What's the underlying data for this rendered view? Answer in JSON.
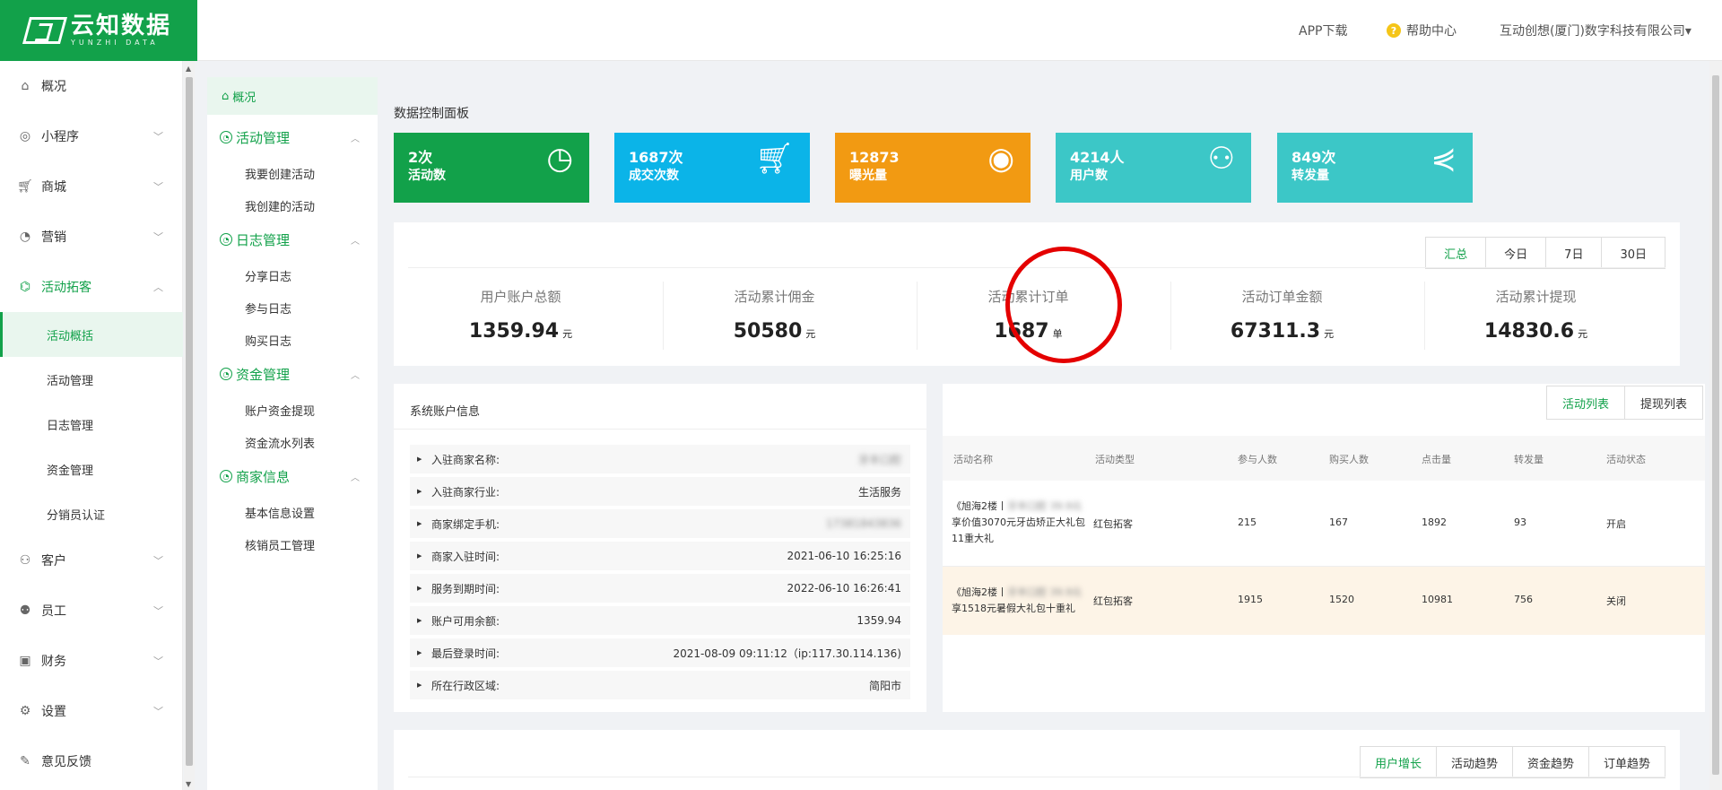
{
  "header": {
    "logo_cn": "云知数据",
    "logo_en": "YUNZHI DATA",
    "app_download": "APP下载",
    "help_center": "帮助中心",
    "company": "互动创想(厦门)数字科技有限公司▾"
  },
  "sidebar": {
    "items": [
      {
        "label": "概况",
        "icon": "home-icon"
      },
      {
        "label": "小程序",
        "icon": "miniprogram-icon"
      },
      {
        "label": "商城",
        "icon": "cart-icon"
      },
      {
        "label": "营销",
        "icon": "marketing-icon"
      },
      {
        "label": "活动拓客",
        "icon": "network-icon"
      },
      {
        "label": "客户",
        "icon": "customer-icon"
      },
      {
        "label": "员工",
        "icon": "staff-icon"
      },
      {
        "label": "财务",
        "icon": "wallet-icon"
      },
      {
        "label": "设置",
        "icon": "gear-icon"
      },
      {
        "label": "意见反馈",
        "icon": "feedback-icon"
      }
    ],
    "sub_items": [
      "活动概括",
      "活动管理",
      "日志管理",
      "资金管理",
      "分销员认证"
    ]
  },
  "submenu": {
    "top": "概况",
    "groups": [
      {
        "label": "活动管理",
        "items": [
          "我要创建活动",
          "我创建的活动"
        ]
      },
      {
        "label": "日志管理",
        "items": [
          "分享日志",
          "参与日志",
          "购买日志"
        ]
      },
      {
        "label": "资金管理",
        "items": [
          "账户资金提现",
          "资金流水列表"
        ]
      },
      {
        "label": "商家信息",
        "items": [
          "基本信息设置",
          "核销员工管理"
        ]
      }
    ]
  },
  "main": {
    "title": "数据控制面板",
    "cards": [
      {
        "value": "2次",
        "label": "活动数",
        "color": "#12a14a",
        "icon": "clock-icon"
      },
      {
        "value": "1687次",
        "label": "成交次数",
        "color": "#0bb4e8",
        "icon": "cart-icon"
      },
      {
        "value": "12873",
        "label": "曝光量",
        "color": "#f29a12",
        "icon": "eye-icon"
      },
      {
        "value": "4214人",
        "label": "用户数",
        "color": "#3cc7c7",
        "icon": "user-icon"
      },
      {
        "value": "849次",
        "label": "转发量",
        "color": "#3cc7c7",
        "icon": "share-icon"
      }
    ],
    "summary_tabs": [
      "汇总",
      "今日",
      "7日",
      "30日"
    ],
    "metrics": [
      {
        "title": "用户账户总额",
        "value": "1359.94",
        "unit": "元"
      },
      {
        "title": "活动累计佣金",
        "value": "50580",
        "unit": "元"
      },
      {
        "title": "活动累计订单",
        "value": "1687",
        "unit": "单"
      },
      {
        "title": "活动订单金额",
        "value": "67311.3",
        "unit": "元"
      },
      {
        "title": "活动累计提现",
        "value": "14830.6",
        "unit": "元"
      }
    ],
    "account": {
      "title": "系统账户信息",
      "rows": [
        {
          "label": "入驻商家名称:",
          "value": "牙丰口腔",
          "blur": true
        },
        {
          "label": "入驻商家行业:",
          "value": "生活服务"
        },
        {
          "label": "商家绑定手机:",
          "value": "17381843836",
          "blur": true
        },
        {
          "label": "商家入驻时间:",
          "value": "2021-06-10 16:25:16"
        },
        {
          "label": "服务到期时间:",
          "value": "2022-06-10 16:26:41"
        },
        {
          "label": "账户可用余额:",
          "value": "1359.94"
        },
        {
          "label": "最后登录时间:",
          "value": "2021-08-09 09:11:12（ip:117.30.114.136)"
        },
        {
          "label": "所在行政区域:",
          "value": "简阳市"
        }
      ]
    },
    "activity": {
      "tabs": [
        "活动列表",
        "提现列表"
      ],
      "columns": [
        "活动名称",
        "活动类型",
        "参与人数",
        "购买人数",
        "点击量",
        "转发量",
        "活动状态"
      ],
      "rows": [
        {
          "name_a": "《旭海2楼丨",
          "name_blur": "牙丰口腔 39.9元",
          "name_b": "享价值3070元牙齿矫正大礼包11重大礼",
          "type": "红包拓客",
          "join": "215",
          "buy": "167",
          "clicks": "1892",
          "shares": "93",
          "status": "开启"
        },
        {
          "name_a": "《旭海2楼丨",
          "name_blur": "牙丰口腔 39.9元",
          "name_b": "享1518元暑假大礼包十重礼",
          "type": "红包拓客",
          "join": "1915",
          "buy": "1520",
          "clicks": "10981",
          "shares": "756",
          "status": "关闭"
        }
      ]
    },
    "trend_tabs": [
      "用户增长",
      "活动趋势",
      "资金趋势",
      "订单趋势"
    ]
  }
}
